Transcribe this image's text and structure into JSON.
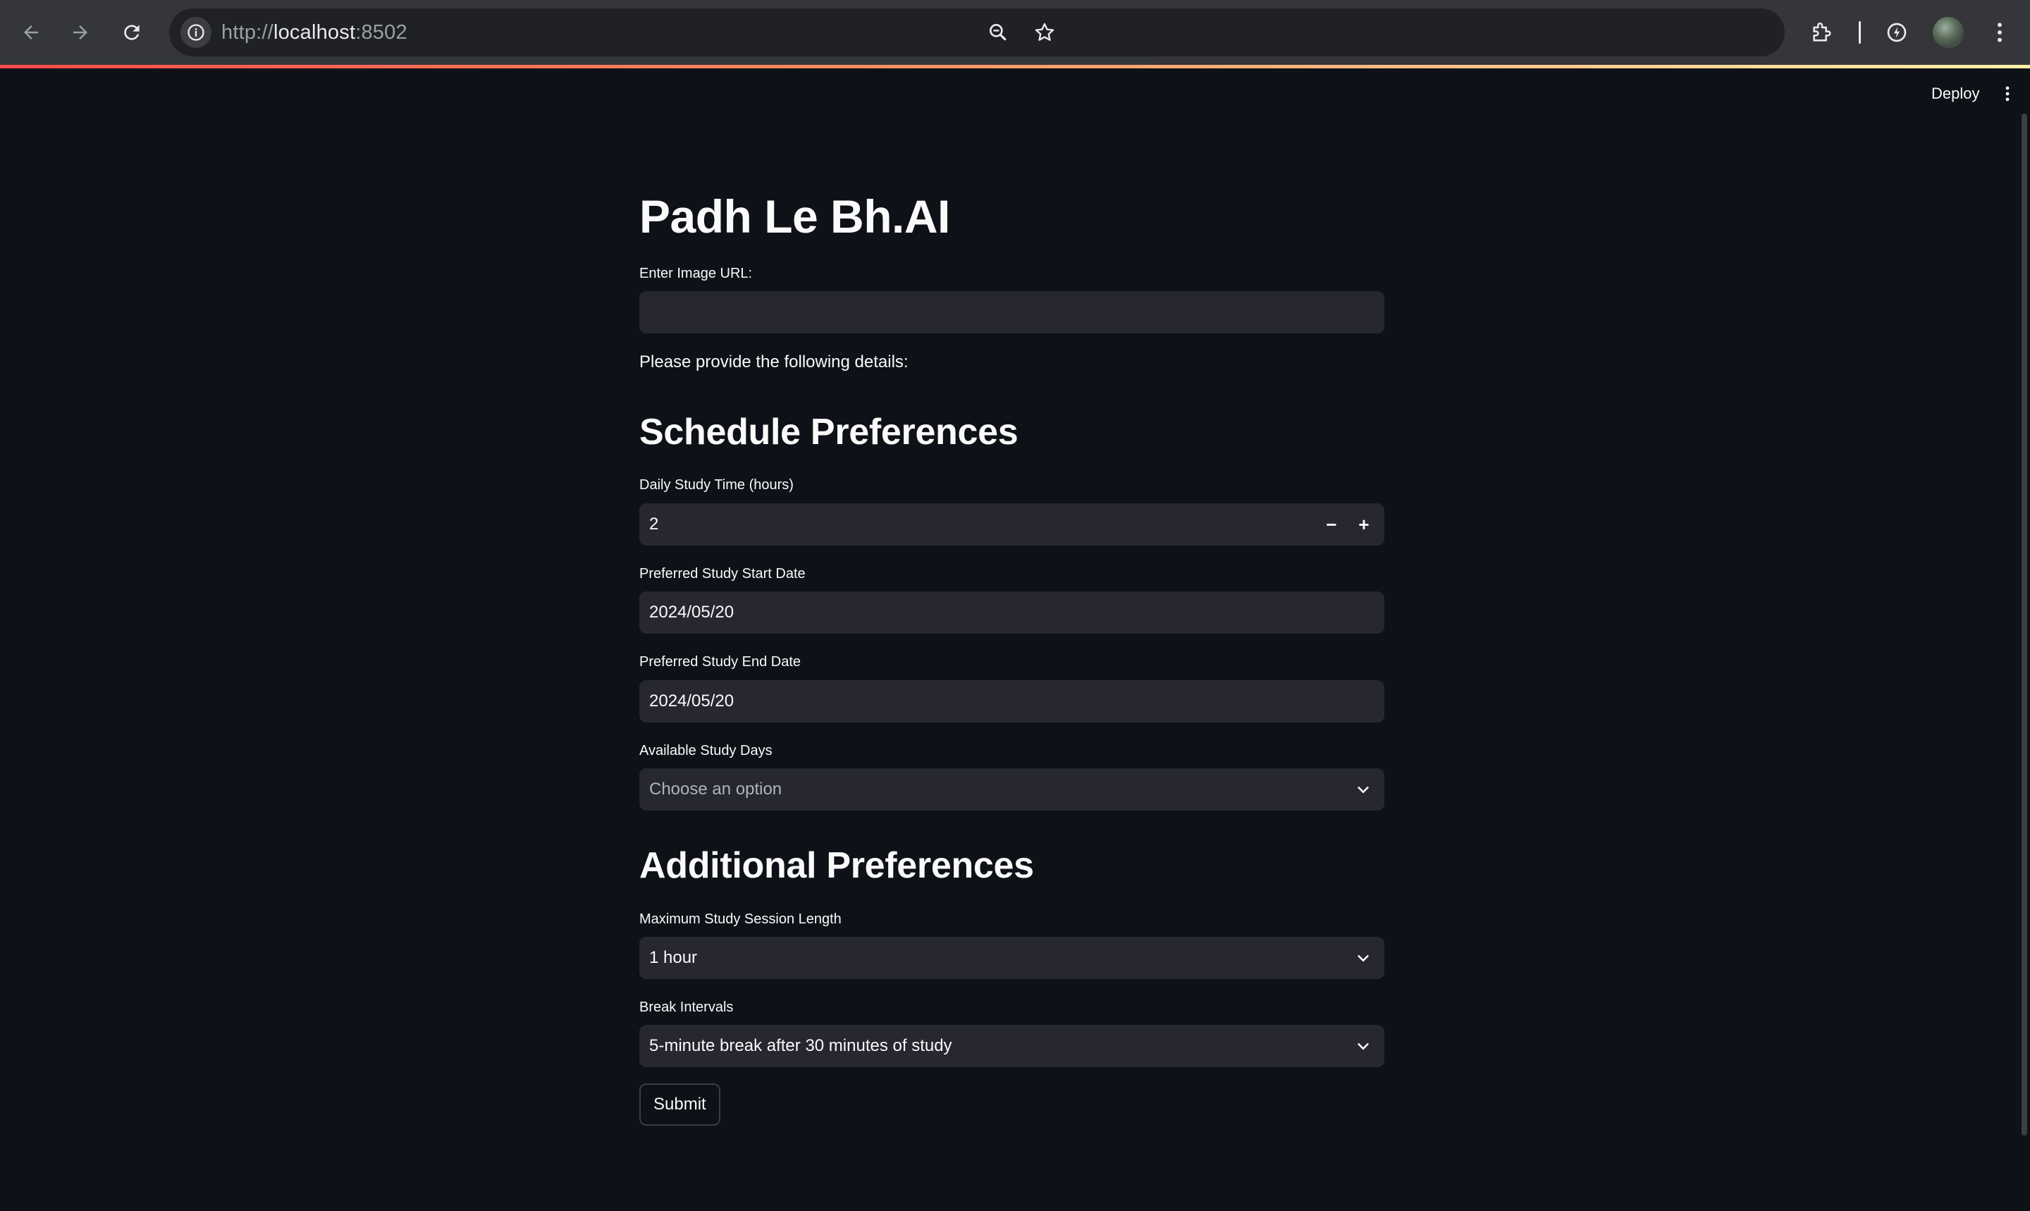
{
  "browser": {
    "url_scheme": "http://",
    "url_host": "localhost",
    "url_port": ":8502",
    "icons": [
      "back-icon",
      "forward-icon",
      "reload-icon",
      "site-info-icon",
      "zoom-icon",
      "bookmark-star-icon",
      "extensions-icon",
      "performance-icon",
      "profile-avatar",
      "menu-icon"
    ]
  },
  "toolbar": {
    "deploy_label": "Deploy"
  },
  "app": {
    "title": "Padh Le Bh.AI",
    "image_url": {
      "label": "Enter Image URL:",
      "value": ""
    },
    "instructions": "Please provide the following details:",
    "schedule": {
      "heading": "Schedule Preferences",
      "daily_time": {
        "label": "Daily Study Time (hours)",
        "value": "2",
        "minus": "−",
        "plus": "+"
      },
      "start_date": {
        "label": "Preferred Study Start Date",
        "value": "2024/05/20"
      },
      "end_date": {
        "label": "Preferred Study End Date",
        "value": "2024/05/20"
      },
      "days": {
        "label": "Available Study Days",
        "placeholder": "Choose an option"
      }
    },
    "additional": {
      "heading": "Additional Preferences",
      "session_length": {
        "label": "Maximum Study Session Length",
        "value": "1 hour"
      },
      "break_intervals": {
        "label": "Break Intervals",
        "value": "5-minute break after 30 minutes of study"
      }
    },
    "submit_label": "Submit"
  },
  "colors": {
    "background": "#0e1117",
    "input_bg": "#262730",
    "text": "#fafafa",
    "accent_red": "#ff4b4b"
  }
}
